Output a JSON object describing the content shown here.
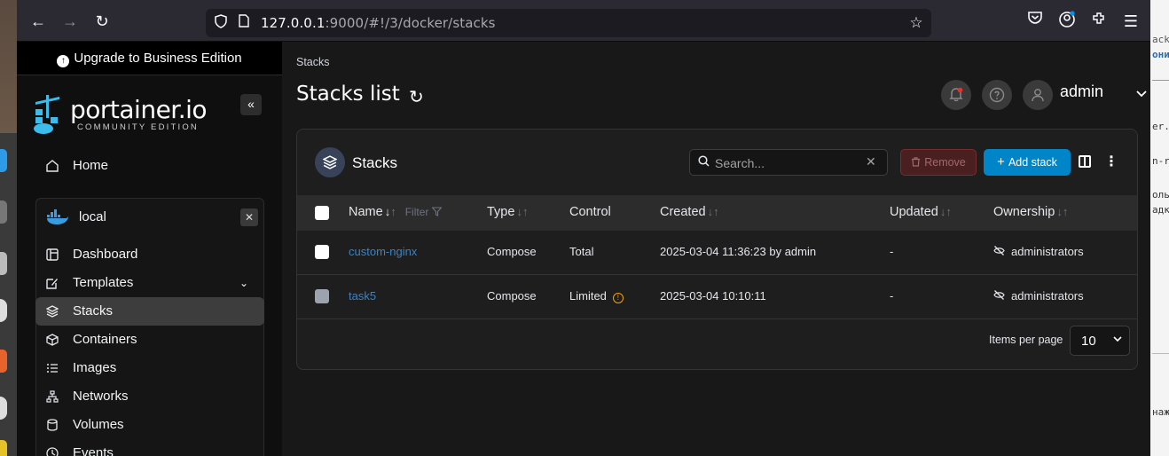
{
  "browser": {
    "url_host": "127.0.0.1",
    "url_rest": ":9000/#!/3/docker/stacks"
  },
  "sidebar": {
    "upgrade_label": "Upgrade to Business Edition",
    "logo_word": "portainer.io",
    "logo_edition": "COMMUNITY EDITION",
    "home_label": "Home",
    "environment": {
      "name": "local",
      "items": [
        {
          "label": "Dashboard",
          "icon": "dashboard-icon"
        },
        {
          "label": "Templates",
          "icon": "templates-icon"
        },
        {
          "label": "Stacks",
          "icon": "stacks-icon"
        },
        {
          "label": "Containers",
          "icon": "containers-icon"
        },
        {
          "label": "Images",
          "icon": "images-icon"
        },
        {
          "label": "Networks",
          "icon": "networks-icon"
        },
        {
          "label": "Volumes",
          "icon": "volumes-icon"
        },
        {
          "label": "Events",
          "icon": "events-icon"
        }
      ],
      "active": "Stacks"
    }
  },
  "header": {
    "breadcrumb": "Stacks",
    "title": "Stacks list",
    "user": "admin"
  },
  "stacks_card": {
    "title": "Stacks",
    "search_placeholder": "Search...",
    "remove_label": "Remove",
    "add_label": "Add stack",
    "columns": {
      "name": "Name",
      "filter": "Filter",
      "type": "Type",
      "control": "Control",
      "created": "Created",
      "updated": "Updated",
      "ownership": "Ownership"
    },
    "rows": [
      {
        "name": "custom-nginx",
        "type": "Compose",
        "control": "Total",
        "created": "2025-03-04 11:36:23 by admin",
        "updated": "-",
        "ownership": "administrators",
        "selectable": true
      },
      {
        "name": "task5",
        "type": "Compose",
        "control": "Limited",
        "created": "2025-03-04 10:10:11",
        "updated": "-",
        "ownership": "administrators",
        "selectable": false
      }
    ],
    "items_per_page_label": "Items per page",
    "items_per_page": "10"
  },
  "colors": {
    "accent": "#0085c9",
    "link": "#3b82c4",
    "warning": "#f59e0b",
    "danger_bg": "#4a1f1f"
  }
}
